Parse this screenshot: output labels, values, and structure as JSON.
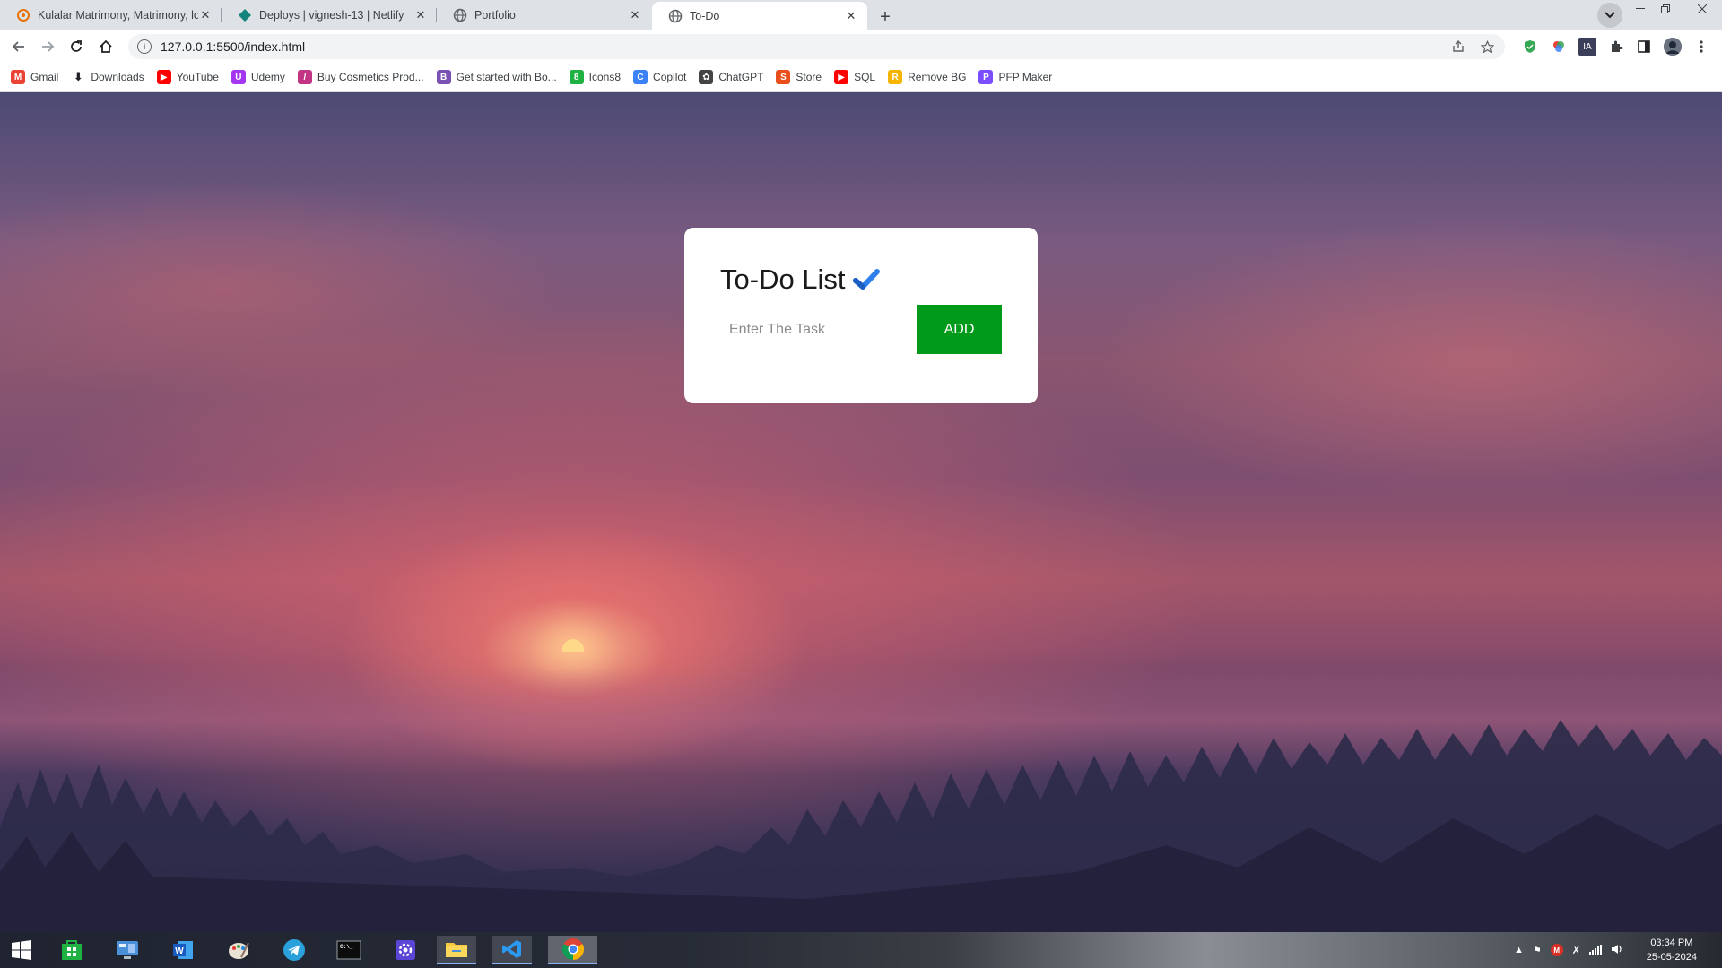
{
  "browser": {
    "tabs": [
      {
        "title": "Kulalar Matrimony, Matrimony, lo",
        "favicon": "kulalar-favicon",
        "active": false
      },
      {
        "title": "Deploys | vignesh-13 | Netlify",
        "favicon": "netlify-favicon",
        "active": false
      },
      {
        "title": "Portfolio",
        "favicon": "globe-icon",
        "active": false
      },
      {
        "title": "To-Do",
        "favicon": "globe-icon",
        "active": true
      }
    ],
    "new_tab_symbol": "+",
    "close_symbol": "✕",
    "address": "127.0.0.1:5500/index.html"
  },
  "bookmarks": [
    {
      "label": "Gmail",
      "icon": "gmail-icon",
      "color": "#ea4335",
      "glyph": "M"
    },
    {
      "label": "Downloads",
      "icon": "download-icon",
      "color": "#202124",
      "glyph": "⬇"
    },
    {
      "label": "YouTube",
      "icon": "youtube-icon",
      "color": "#ff0000",
      "glyph": "▶"
    },
    {
      "label": "Udemy",
      "icon": "udemy-icon",
      "color": "#a435f0",
      "glyph": "U"
    },
    {
      "label": "Buy Cosmetics Prod...",
      "icon": "cosmetics-icon",
      "color": "#c13584",
      "glyph": "/"
    },
    {
      "label": "Get started with Bo...",
      "icon": "bootstrap-icon",
      "color": "#7952b3",
      "glyph": "B"
    },
    {
      "label": "Icons8",
      "icon": "icons8-icon",
      "color": "#1fb141",
      "glyph": "8"
    },
    {
      "label": "Copilot",
      "icon": "copilot-icon",
      "color": "#3b82f6",
      "glyph": "C"
    },
    {
      "label": "ChatGPT",
      "icon": "chatgpt-icon",
      "color": "#444444",
      "glyph": "✿"
    },
    {
      "label": "Store",
      "icon": "store-icon",
      "color": "#e94e1b",
      "glyph": "S"
    },
    {
      "label": "SQL",
      "icon": "youtube-icon",
      "color": "#ff0000",
      "glyph": "▶"
    },
    {
      "label": "Remove BG",
      "icon": "removebg-icon",
      "color": "#f5b400",
      "glyph": "R"
    },
    {
      "label": "PFP Maker",
      "icon": "pfp-maker-icon",
      "color": "#7c4dff",
      "glyph": "P"
    }
  ],
  "todo": {
    "title": "To-Do List",
    "input_placeholder": "Enter The Task",
    "input_value": "",
    "add_label": "ADD",
    "accent": "#009a1a",
    "check_color": "#2f80ed"
  },
  "taskbar": {
    "time": "03:34 PM",
    "date": "25-05-2024"
  }
}
